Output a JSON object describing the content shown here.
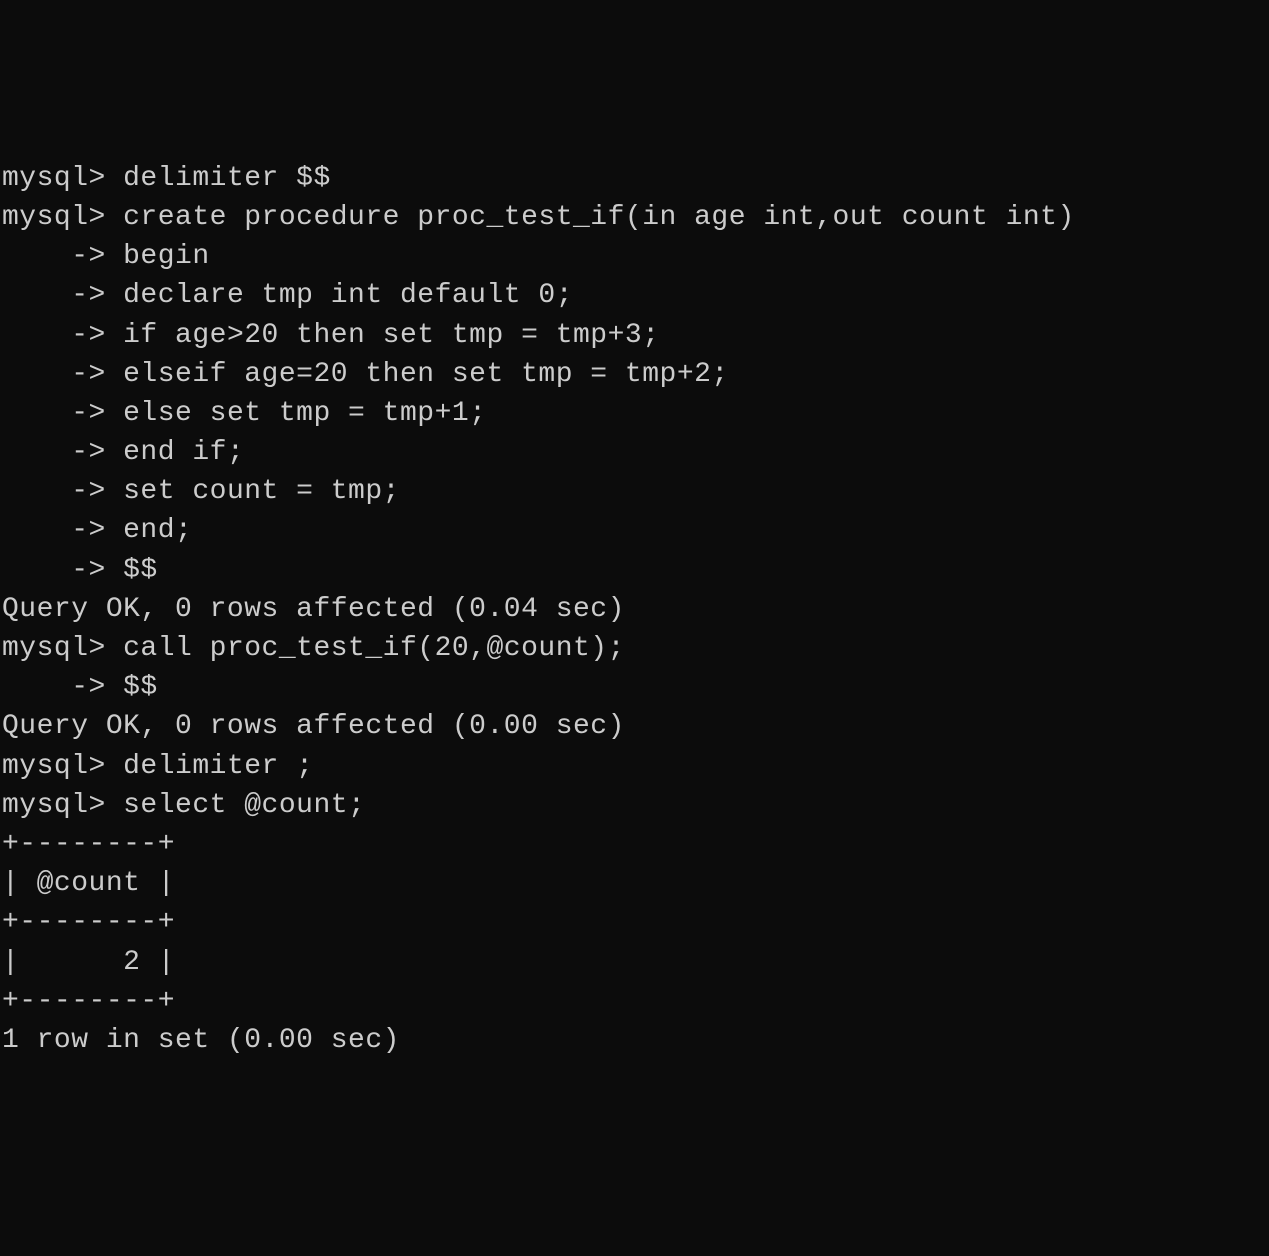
{
  "lines": [
    {
      "prompt": "mysql> ",
      "text": "delimiter $$"
    },
    {
      "prompt": "mysql> ",
      "text": "create procedure proc_test_if(in age int,out count int)"
    },
    {
      "prompt": "    -> ",
      "text": "begin"
    },
    {
      "prompt": "    -> ",
      "text": "declare tmp int default 0;"
    },
    {
      "prompt": "    -> ",
      "text": "if age>20 then set tmp = tmp+3;"
    },
    {
      "prompt": "    -> ",
      "text": "elseif age=20 then set tmp = tmp+2;"
    },
    {
      "prompt": "    -> ",
      "text": "else set tmp = tmp+1;"
    },
    {
      "prompt": "    -> ",
      "text": "end if;"
    },
    {
      "prompt": "    -> ",
      "text": "set count = tmp;"
    },
    {
      "prompt": "    -> ",
      "text": "end;"
    },
    {
      "prompt": "    -> ",
      "text": "$$"
    },
    {
      "prompt": "",
      "text": "Query OK, 0 rows affected (0.04 sec)"
    },
    {
      "prompt": "",
      "text": ""
    },
    {
      "prompt": "mysql> ",
      "text": "call proc_test_if(20,@count);"
    },
    {
      "prompt": "    -> ",
      "text": "$$"
    },
    {
      "prompt": "",
      "text": "Query OK, 0 rows affected (0.00 sec)"
    },
    {
      "prompt": "",
      "text": ""
    },
    {
      "prompt": "mysql> ",
      "text": "delimiter ;"
    },
    {
      "prompt": "mysql> ",
      "text": "select @count;"
    },
    {
      "prompt": "",
      "text": "+--------+"
    },
    {
      "prompt": "",
      "text": "| @count |"
    },
    {
      "prompt": "",
      "text": "+--------+"
    },
    {
      "prompt": "",
      "text": "|      2 |"
    },
    {
      "prompt": "",
      "text": "+--------+"
    },
    {
      "prompt": "",
      "text": "1 row in set (0.00 sec)"
    }
  ]
}
